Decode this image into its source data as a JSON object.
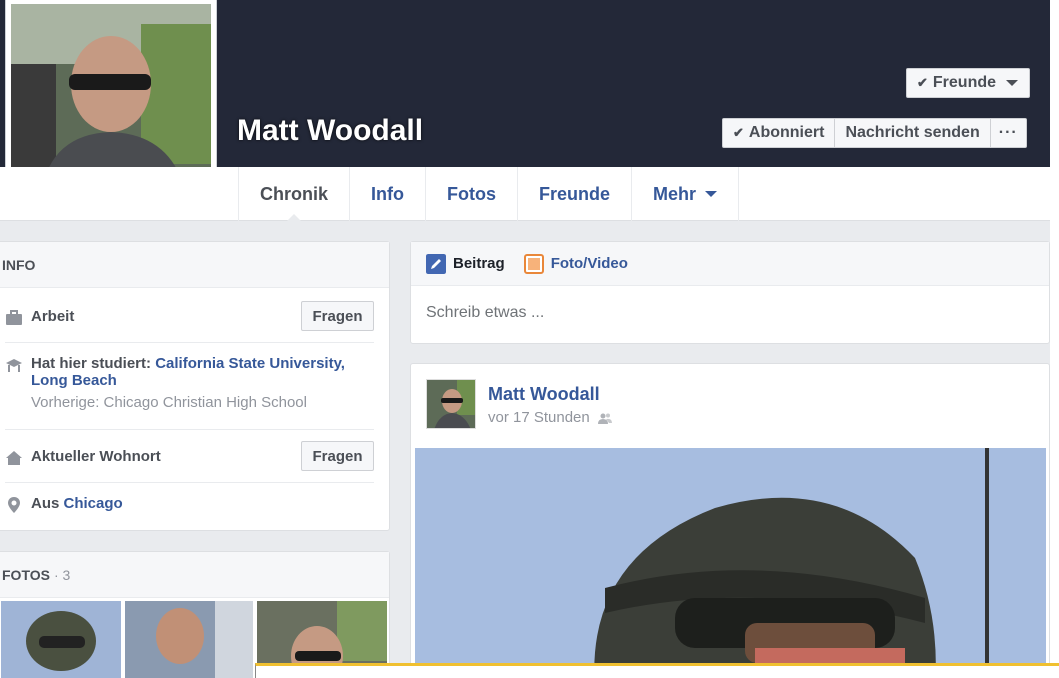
{
  "profile": {
    "name": "Matt Woodall",
    "friends_button": "Freunde",
    "subscribed_button": "Abonniert",
    "message_button": "Nachricht senden",
    "more_actions_glyph": "···"
  },
  "nav": {
    "tabs": [
      {
        "label": "Chronik"
      },
      {
        "label": "Info"
      },
      {
        "label": "Fotos"
      },
      {
        "label": "Freunde"
      },
      {
        "label": "Mehr"
      }
    ]
  },
  "info": {
    "header": "INFO",
    "work_label": "Arbeit",
    "ask_label": "Fragen",
    "studied_prefix": "Hat hier studiert:",
    "studied_school_line1": "California State University,",
    "studied_school_line2": "Long Beach",
    "previous": "Vorherige: Chicago Christian High School",
    "residence_label": "Aktueller Wohnort",
    "from_prefix": "Aus",
    "from_city": "Chicago"
  },
  "photos": {
    "header": "FOTOS",
    "count": "· 3"
  },
  "composer": {
    "tab_post": "Beitrag",
    "tab_photo": "Foto/Video",
    "placeholder": "Schreib etwas ..."
  },
  "post": {
    "author": "Matt Woodall",
    "time": "vor 17 Stunden"
  },
  "colors": {
    "cover": "#232838",
    "link": "#365899",
    "background": "#e9ebee"
  }
}
